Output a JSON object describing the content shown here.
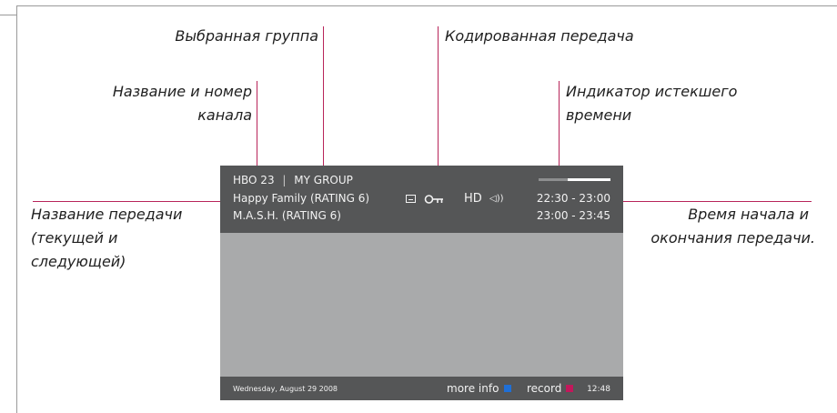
{
  "labels": {
    "selected_group": "Выбранная группа",
    "encoded_program": "Кодированная передача",
    "channel_name_l1": "Название и номер",
    "channel_name_l2": "канала",
    "elapsed_l1": "Индикатор истекшего",
    "elapsed_l2": "времени",
    "program_name_l1": "Название передачи",
    "program_name_l2": "(текущей и",
    "program_name_l3": "следующей)",
    "time_l1": "Время начала и",
    "time_l2": "окончания передачи."
  },
  "screen": {
    "channel": "HBO 23",
    "separator": "|",
    "group": "MY GROUP",
    "current_program": "Happy Family (RATING 6)",
    "next_program": "M.A.S.H. (RATING 6)",
    "hd_label": "HD",
    "speaker_glyph": "◁))",
    "current_time": "22:30 - 23:00",
    "next_time": "23:00 - 23:45",
    "elapsed_fraction": 0.4,
    "date": "Wednesday, August 29 2008",
    "more_info_label": "more info",
    "record_label": "record",
    "clock": "12:48"
  },
  "colors": {
    "pointer": "#b8245a",
    "more_info_square": "#1f6fd6",
    "record_square": "#c2185b"
  },
  "icons": {
    "subtitle": "subtitle-icon",
    "key": "key-icon",
    "speaker": "speaker-icon"
  }
}
